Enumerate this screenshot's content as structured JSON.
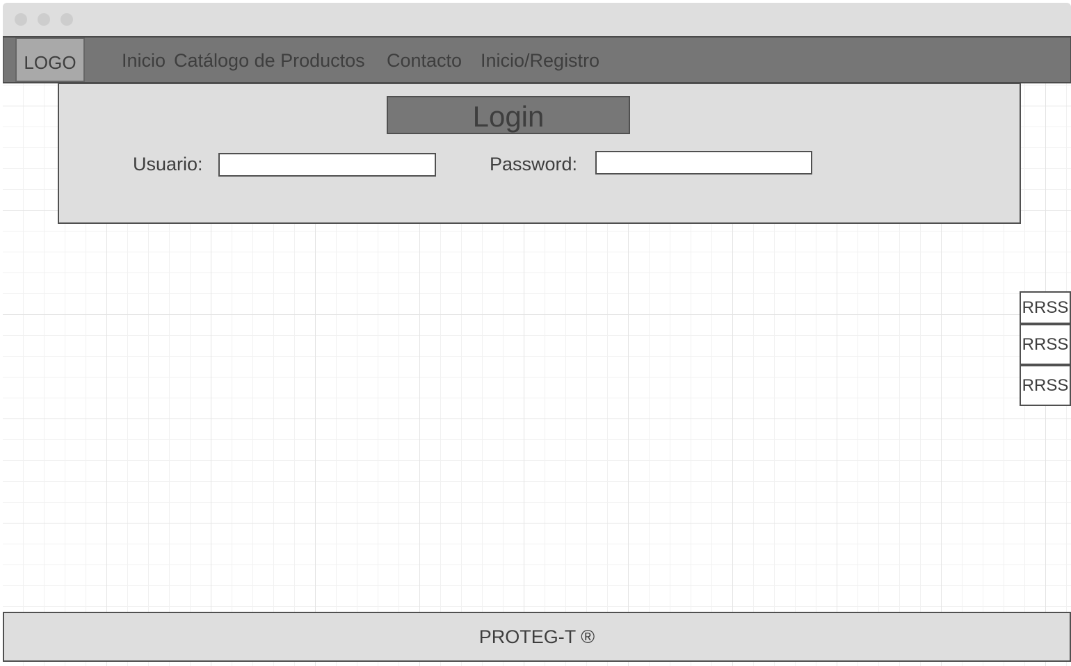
{
  "nav": {
    "logo": "LOGO",
    "items": [
      {
        "label": "Inicio"
      },
      {
        "label": "Catálogo de Productos"
      },
      {
        "label": "Contacto"
      },
      {
        "label": "Inicio/Registro"
      }
    ]
  },
  "login": {
    "title": "Login",
    "user_label": "Usuario:",
    "user_value": "",
    "password_label": "Password:",
    "password_value": ""
  },
  "social": [
    {
      "label": "RRSS"
    },
    {
      "label": "RRSS"
    },
    {
      "label": "RRSS"
    }
  ],
  "footer": {
    "text": "PROTEG-T ®"
  },
  "colors": {
    "navbar": "#767676",
    "panel": "#dedede",
    "text": "#3e3e3e"
  }
}
